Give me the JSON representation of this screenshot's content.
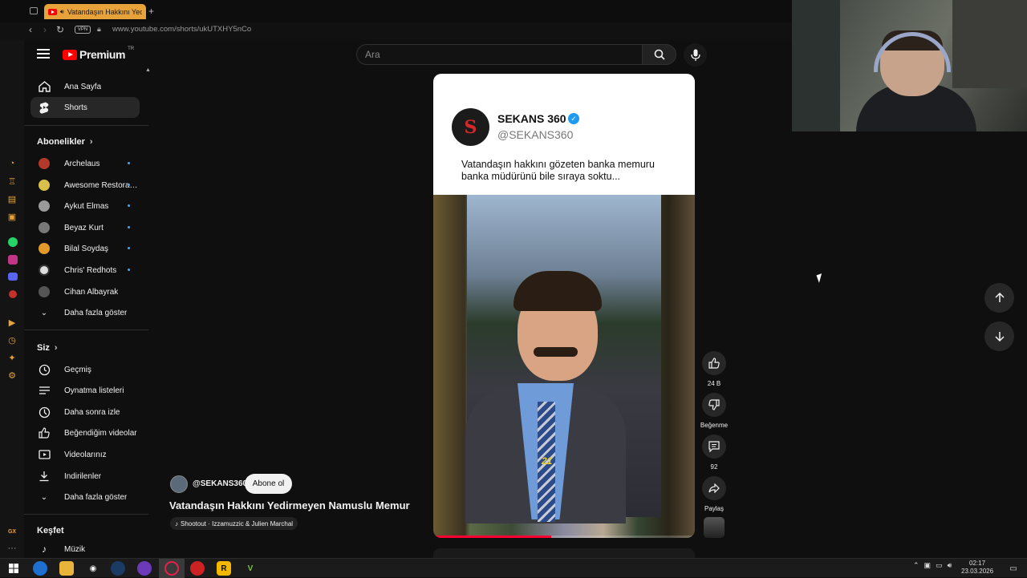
{
  "browser": {
    "tab_title": "Vatandaşın Hakkını Yedirmeyen Namuslu Memur",
    "vpn_label": "VPN",
    "url": "www.youtube.com/shorts/ukUTXHY5nCo"
  },
  "masthead": {
    "logo_text": "Premium",
    "logo_country": "TR",
    "search_placeholder": "Ara"
  },
  "sidebar": {
    "main": [
      {
        "label": "Ana Sayfa",
        "icon": "home-icon"
      },
      {
        "label": "Shorts",
        "icon": "shorts-icon",
        "active": true
      }
    ],
    "subscriptions_header": "Abonelikler",
    "subscriptions": [
      {
        "label": "Archelaus",
        "color": "#b33a2a",
        "new": true
      },
      {
        "label": "Awesome Restorati...",
        "color": "#d8c04a",
        "new": true
      },
      {
        "label": "Aykut Elmas",
        "color": "#9a9a9a",
        "new": true
      },
      {
        "label": "Beyaz Kurt",
        "color": "#777777",
        "new": true
      },
      {
        "label": "Bilal Soydaş",
        "color": "#e39a2a",
        "new": true
      },
      {
        "label": "Chris' Redhots",
        "color": "#dddddd",
        "new": true
      },
      {
        "label": "Cihan Albayrak",
        "color": "#555555",
        "new": false
      }
    ],
    "show_more": "Daha fazla göster",
    "you_header": "Siz",
    "you_items": [
      {
        "label": "Geçmiş",
        "icon": "history-icon"
      },
      {
        "label": "Oynatma listeleri",
        "icon": "playlists-icon"
      },
      {
        "label": "Daha sonra izle",
        "icon": "watch-later-icon"
      },
      {
        "label": "Beğendiğim videolar",
        "icon": "liked-videos-icon"
      },
      {
        "label": "Videolarınız",
        "icon": "your-videos-icon"
      },
      {
        "label": "İndirilenler",
        "icon": "downloads-icon"
      }
    ],
    "show_more_2": "Daha fazla göster",
    "explore_header": "Keşfet",
    "explore_items": [
      {
        "label": "Müzik",
        "icon": "music-icon"
      }
    ]
  },
  "short": {
    "video_channel_name": "SEKANS 360",
    "video_channel_handle": "@SEKANS360",
    "video_caption": "Vatandaşın hakkını gözeten banka memuru banka müdürünü bile sıraya soktu...",
    "logo_letter": "S",
    "tie_number": "21",
    "channel": "@SEKANS360",
    "subscribe": "Abone ol",
    "title": "Vatandaşın Hakkını Yedirmeyen Namuslu Memur",
    "music": "Shootout · Izzamuzzic & Julien Marchal",
    "progress": 0.45
  },
  "actions": {
    "likes": "24 B",
    "dislike": "Beğenme",
    "comments": "92",
    "share": "Paylaş"
  },
  "taskbar": {
    "time": "02:17",
    "date": "23.03.2026"
  },
  "colors": {
    "accent_red": "#ff0000",
    "opera_tab": "#e8a23a",
    "link_blue": "#3ea6ff"
  }
}
